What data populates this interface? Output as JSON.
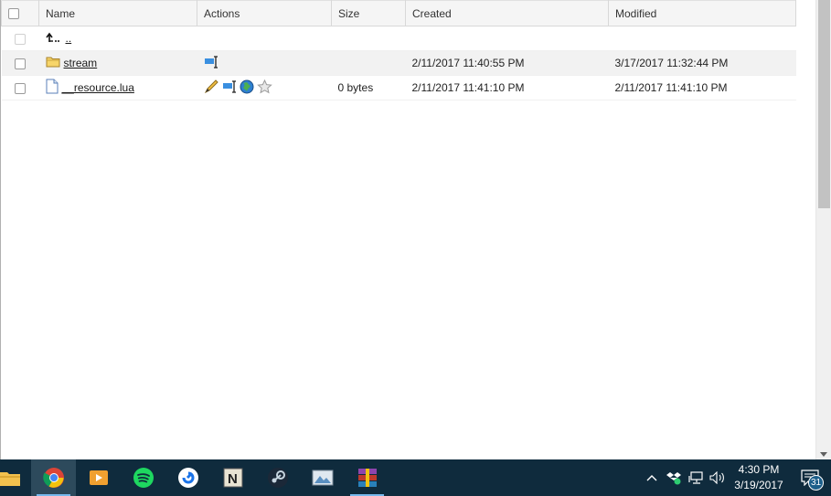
{
  "table": {
    "headers": {
      "name": "Name",
      "actions": "Actions",
      "size": "Size",
      "created": "Created",
      "modified": "Modified"
    },
    "parent_link": "..",
    "rows": [
      {
        "name": "stream",
        "type": "folder",
        "actions": [
          "rename-icon"
        ],
        "size": "",
        "created": "2/11/2017 11:40:55 PM",
        "modified": "3/17/2017 11:32:44 PM"
      },
      {
        "name": "__resource.lua",
        "type": "file",
        "actions": [
          "edit-icon",
          "rename-icon",
          "globe-icon",
          "star-icon"
        ],
        "size": "0 bytes",
        "created": "2/11/2017 11:41:10 PM",
        "modified": "2/11/2017 11:41:10 PM"
      }
    ]
  },
  "taskbar": {
    "apps": [
      "file-explorer-icon",
      "chrome-icon",
      "media-player-icon",
      "spotify-icon",
      "app-icon",
      "notepad-icon",
      "steam-icon",
      "image-viewer-icon",
      "winrar-icon"
    ],
    "clock": {
      "time": "4:30 PM",
      "date": "3/19/2017"
    },
    "notification_count": "31"
  },
  "colors": {
    "taskbar_bg": "#0f2b3d",
    "header_bg": "#f5f5f5",
    "alt_row_bg": "#f2f2f2"
  }
}
